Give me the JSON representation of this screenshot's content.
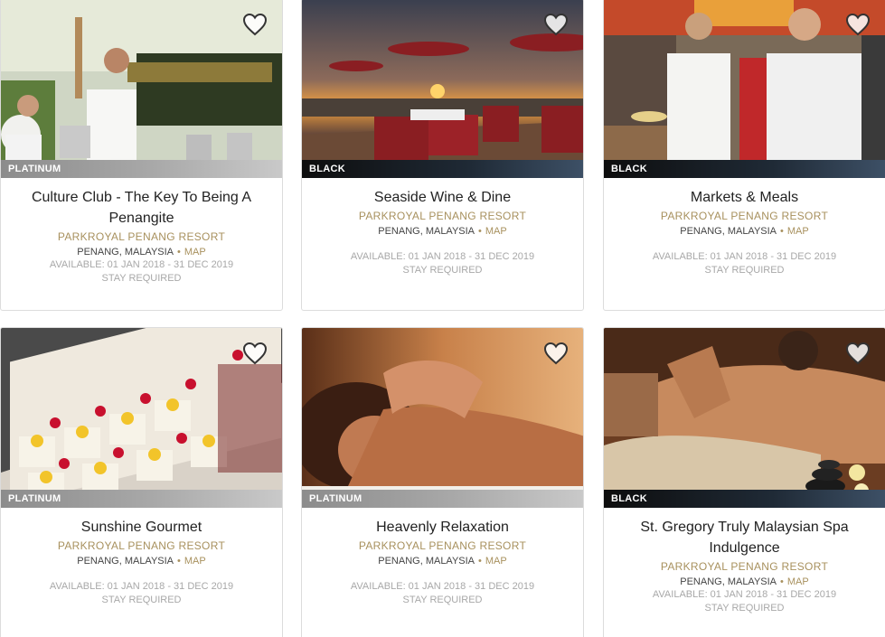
{
  "cards": [
    {
      "tier": "PLATINUM",
      "title": "Culture Club - The Key To Being A Penangite",
      "hotel": "PARKROYAL PENANG RESORT",
      "location": "PENANG, MALAYSIA",
      "map_label": "MAP",
      "availability": "AVAILABLE: 01 JAN 2018 - 31 DEC 2019",
      "requirement": "STAY REQUIRED"
    },
    {
      "tier": "BLACK",
      "title": "Seaside Wine & Dine",
      "hotel": "PARKROYAL PENANG RESORT",
      "location": "PENANG, MALAYSIA",
      "map_label": "MAP",
      "availability": "AVAILABLE: 01 JAN 2018 - 31 DEC 2019",
      "requirement": "STAY REQUIRED"
    },
    {
      "tier": "BLACK",
      "title": "Markets & Meals",
      "hotel": "PARKROYAL PENANG RESORT",
      "location": "PENANG, MALAYSIA",
      "map_label": "MAP",
      "availability": "AVAILABLE: 01 JAN 2018 - 31 DEC 2019",
      "requirement": "STAY REQUIRED"
    },
    {
      "tier": "PLATINUM",
      "title": "Sunshine Gourmet",
      "hotel": "PARKROYAL PENANG RESORT",
      "location": "PENANG, MALAYSIA",
      "map_label": "MAP",
      "availability": "AVAILABLE: 01 JAN 2018 - 31 DEC 2019",
      "requirement": "STAY REQUIRED"
    },
    {
      "tier": "PLATINUM",
      "title": "Heavenly Relaxation",
      "hotel": "PARKROYAL PENANG RESORT",
      "location": "PENANG, MALAYSIA",
      "map_label": "MAP",
      "availability": "AVAILABLE: 01 JAN 2018 - 31 DEC 2019",
      "requirement": "STAY REQUIRED"
    },
    {
      "tier": "BLACK",
      "title": "St. Gregory Truly Malaysian Spa Indulgence",
      "hotel": "PARKROYAL PENANG RESORT",
      "location": "PENANG, MALAYSIA",
      "map_label": "MAP",
      "availability": "AVAILABLE: 01 JAN 2018 - 31 DEC 2019",
      "requirement": "STAY REQUIRED"
    }
  ],
  "colors": {
    "accent_gold": "#a8915e",
    "heart_fill": "#ffffff",
    "heart_stroke": "#333333"
  },
  "icons": {
    "favorite": "heart-outline-icon",
    "separator": "dot"
  }
}
